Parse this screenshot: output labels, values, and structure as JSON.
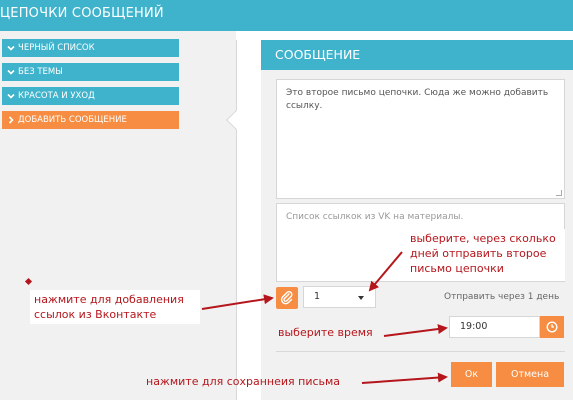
{
  "header": {
    "title": "ЦЕПОЧКИ СООБЩЕНИЙ"
  },
  "sidebar": {
    "items": [
      {
        "label": "ЧЕРНЫЙ СПИСОК"
      },
      {
        "label": "БЕЗ ТЕМЫ"
      },
      {
        "label": "КРАСОТА И УХОД"
      },
      {
        "label": "ДОБАВИТЬ СООБЩЕНИЕ"
      }
    ]
  },
  "message": {
    "title": "СООБЩЕНИЕ",
    "body": "Это второе письмо цепочки. Сюда же можно добавить ссылку.",
    "links_placeholder": "Список ссылкок из VK на материалы.",
    "days_value": "1",
    "send_text": "Отправить через 1 день",
    "time_value": "19:00",
    "ok_label": "Ок",
    "cancel_label": "Отмена"
  },
  "annotations": {
    "days": "выберите, через сколько дней отправить второе письмо цепочки",
    "attach": "нажмите для добавления ссылок из Вконтакте",
    "time": "выберите время",
    "save": "нажмите для сохраннеия письма"
  },
  "colors": {
    "accent": "#3fb3cb",
    "orange": "#f68d42",
    "annotation": "#b5161c"
  }
}
